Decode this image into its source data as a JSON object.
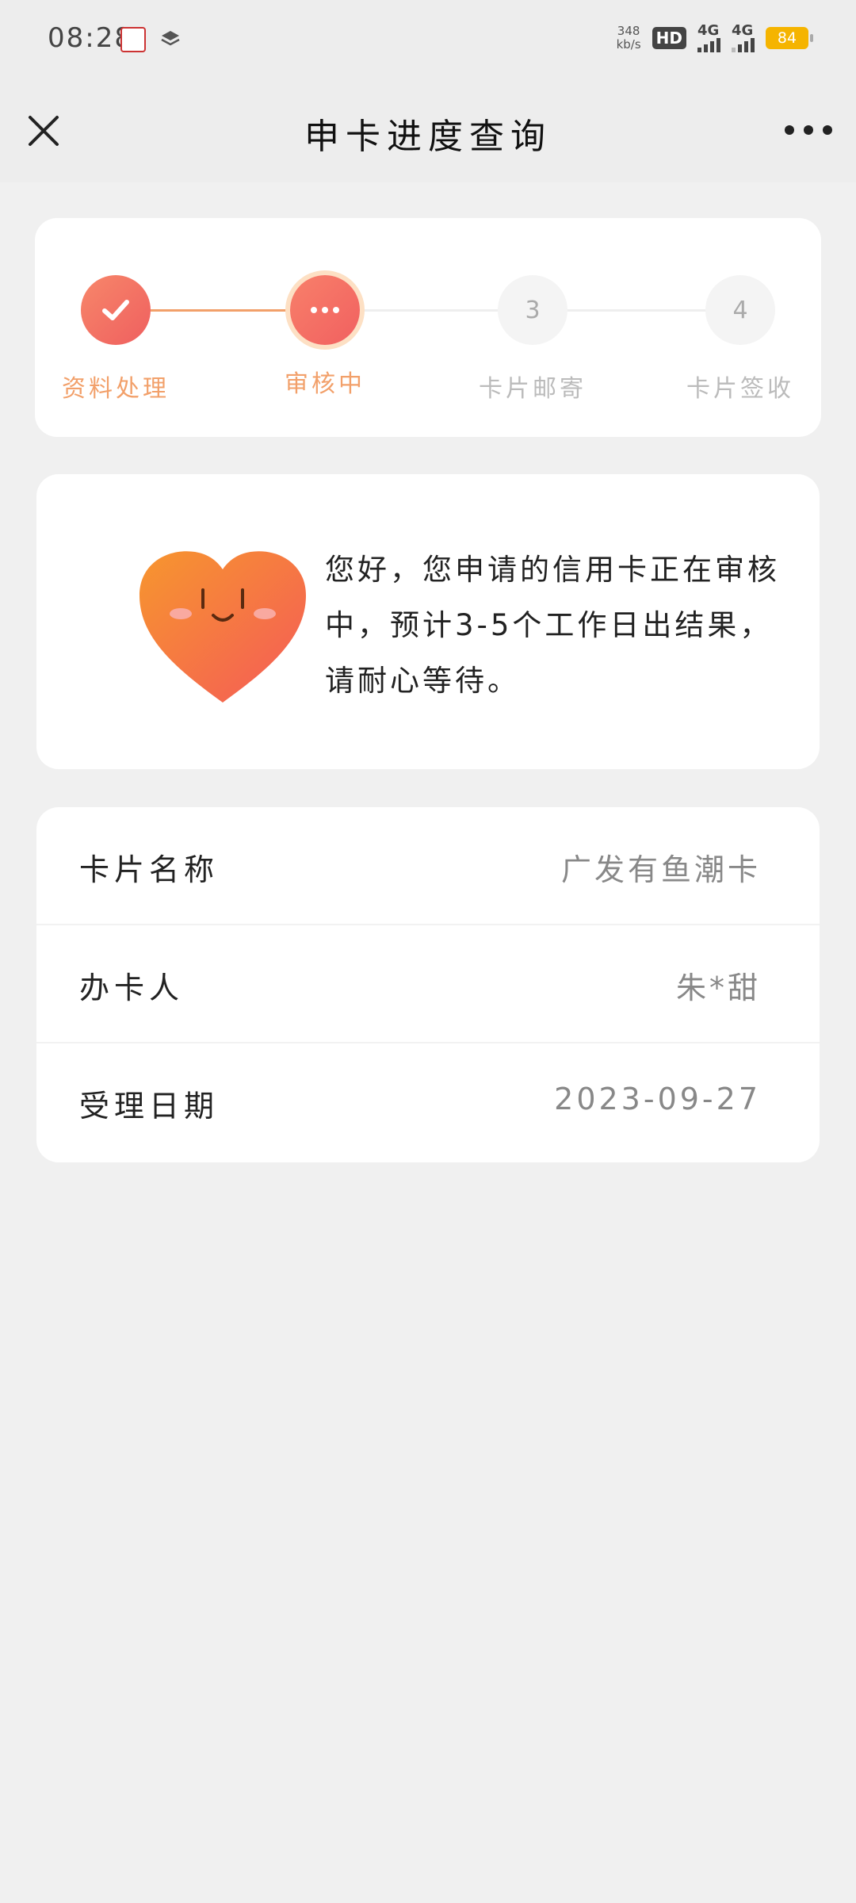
{
  "status_bar": {
    "time": "08:28",
    "net_speed_value": "348",
    "net_speed_unit": "kb/s",
    "hd_label": "HD",
    "sim1_label": "4G",
    "sim2_label": "4G",
    "battery": "84"
  },
  "nav": {
    "title": "申卡进度查询"
  },
  "steps": [
    {
      "number": "",
      "label": "资料处理",
      "state": "done"
    },
    {
      "number": "",
      "label": "审核中",
      "state": "active"
    },
    {
      "number": "3",
      "label": "卡片邮寄",
      "state": "pending"
    },
    {
      "number": "4",
      "label": "卡片签收",
      "state": "pending"
    }
  ],
  "message": {
    "text": "您好，您申请的信用卡正在审核中，预计3-5个工作日出结果，请耐心等待。"
  },
  "info": {
    "rows": [
      {
        "label": "卡片名称",
        "value": "广发有鱼潮卡"
      },
      {
        "label": "办卡人",
        "value": "朱*甜"
      },
      {
        "label": "受理日期",
        "value": "2023-09-27"
      }
    ]
  },
  "colors": {
    "accent": "#f16060",
    "accent_light": "#f2a06a",
    "page_bg": "#f0f0f0"
  },
  "icons": {
    "close": "close-icon",
    "more": "more-icon",
    "check": "check-icon",
    "dots": "ellipsis-icon",
    "heart": "smiling-heart-icon"
  }
}
